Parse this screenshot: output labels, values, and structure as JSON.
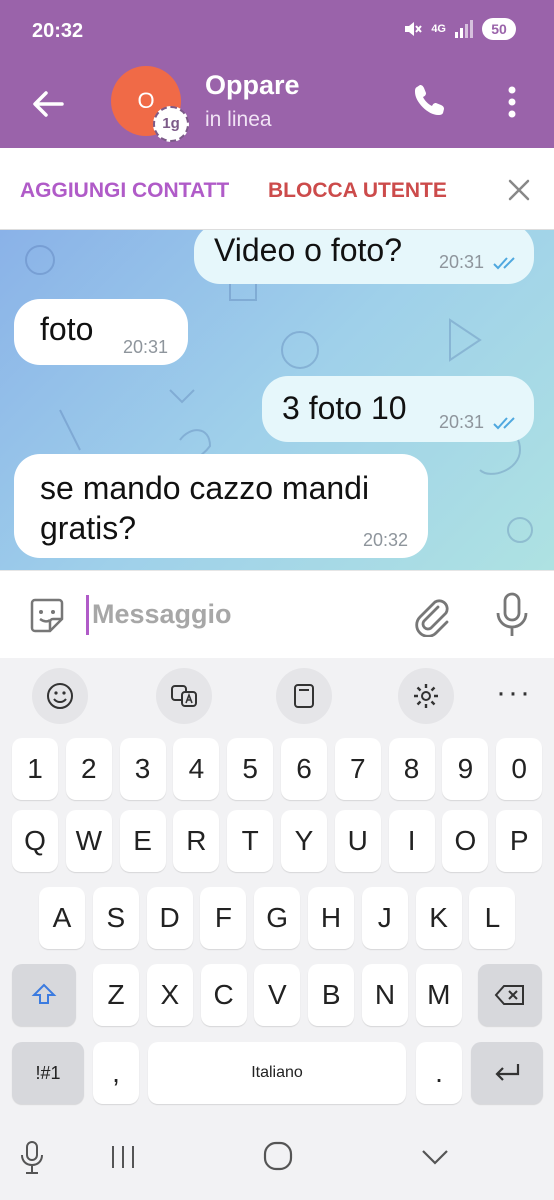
{
  "status_bar": {
    "time": "20:32",
    "network": "4G",
    "battery": "50"
  },
  "header": {
    "avatar_initial": "O",
    "badge": "1g",
    "name": "Oppare",
    "presence": "in linea"
  },
  "action_bar": {
    "add_contact": "AGGIUNGI CONTATT",
    "block_user": "BLOCCA UTENTE"
  },
  "messages": [
    {
      "direction": "out",
      "text": "Video o foto?",
      "time": "20:31",
      "read": true
    },
    {
      "direction": "in",
      "text": "foto",
      "time": "20:31"
    },
    {
      "direction": "out",
      "text": "3 foto 10",
      "time": "20:31",
      "read": true
    },
    {
      "direction": "in",
      "text_line1": "se mando cazzo mandi",
      "text_line2": "gratis?",
      "time": "20:32"
    }
  ],
  "composer": {
    "placeholder": "Messaggio"
  },
  "keyboard": {
    "numbers": [
      "1",
      "2",
      "3",
      "4",
      "5",
      "6",
      "7",
      "8",
      "9",
      "0"
    ],
    "row1": [
      "Q",
      "W",
      "E",
      "R",
      "T",
      "Y",
      "U",
      "I",
      "O",
      "P"
    ],
    "row2": [
      "A",
      "S",
      "D",
      "F",
      "G",
      "H",
      "J",
      "K",
      "L"
    ],
    "row3": [
      "Z",
      "X",
      "C",
      "V",
      "B",
      "N",
      "M"
    ],
    "symbols_key": "!#1",
    "comma": ",",
    "space": "Italiano",
    "period": "."
  },
  "colors": {
    "header": "#9a63aa",
    "accent": "#b05bc8",
    "danger": "#cc4b4b",
    "read_ticks": "#4fa8df"
  }
}
